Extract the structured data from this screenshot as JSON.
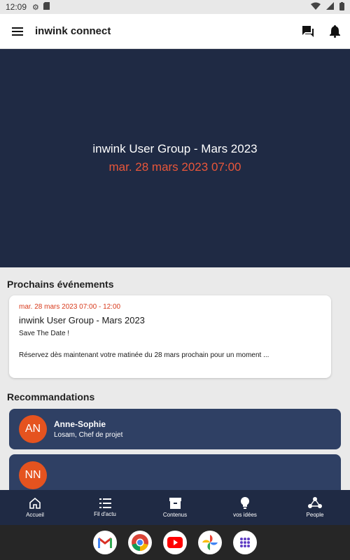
{
  "status_bar": {
    "time": "12:09"
  },
  "app_bar": {
    "title": "inwink connect"
  },
  "hero": {
    "event_name": "inwink User Group - Mars 2023",
    "event_date": "mar. 28 mars 2023 07:00"
  },
  "sections": {
    "upcoming": "Prochains événements",
    "recommendations": "Recommandations"
  },
  "event_card": {
    "date": "mar. 28 mars 2023 07:00 - 12:00",
    "title": "inwink User Group - Mars 2023",
    "subtitle": "Save The Date !",
    "description": "Réservez dès maintenant votre matinée du 28 mars prochain pour un moment ..."
  },
  "recommendations": [
    {
      "initials": "AN",
      "name": "Anne-Sophie",
      "role": "Losam, Chef de projet"
    },
    {
      "initials": "NN",
      "name": "",
      "role": ""
    }
  ],
  "bottom_nav": [
    {
      "label": "Accueil",
      "icon": "home-icon"
    },
    {
      "label": "Fil d'actu",
      "icon": "list-icon"
    },
    {
      "label": "Contenus",
      "icon": "archive-icon"
    },
    {
      "label": "vos idées",
      "icon": "lightbulb-icon"
    },
    {
      "label": "People",
      "icon": "people-icon"
    }
  ],
  "colors": {
    "primary": "#1f2a44",
    "card": "#2f4064",
    "accent": "#e5531f",
    "date_red": "#d83a1c"
  },
  "dock": [
    "gmail-icon",
    "chrome-icon",
    "youtube-icon",
    "photos-icon",
    "apps-icon"
  ]
}
